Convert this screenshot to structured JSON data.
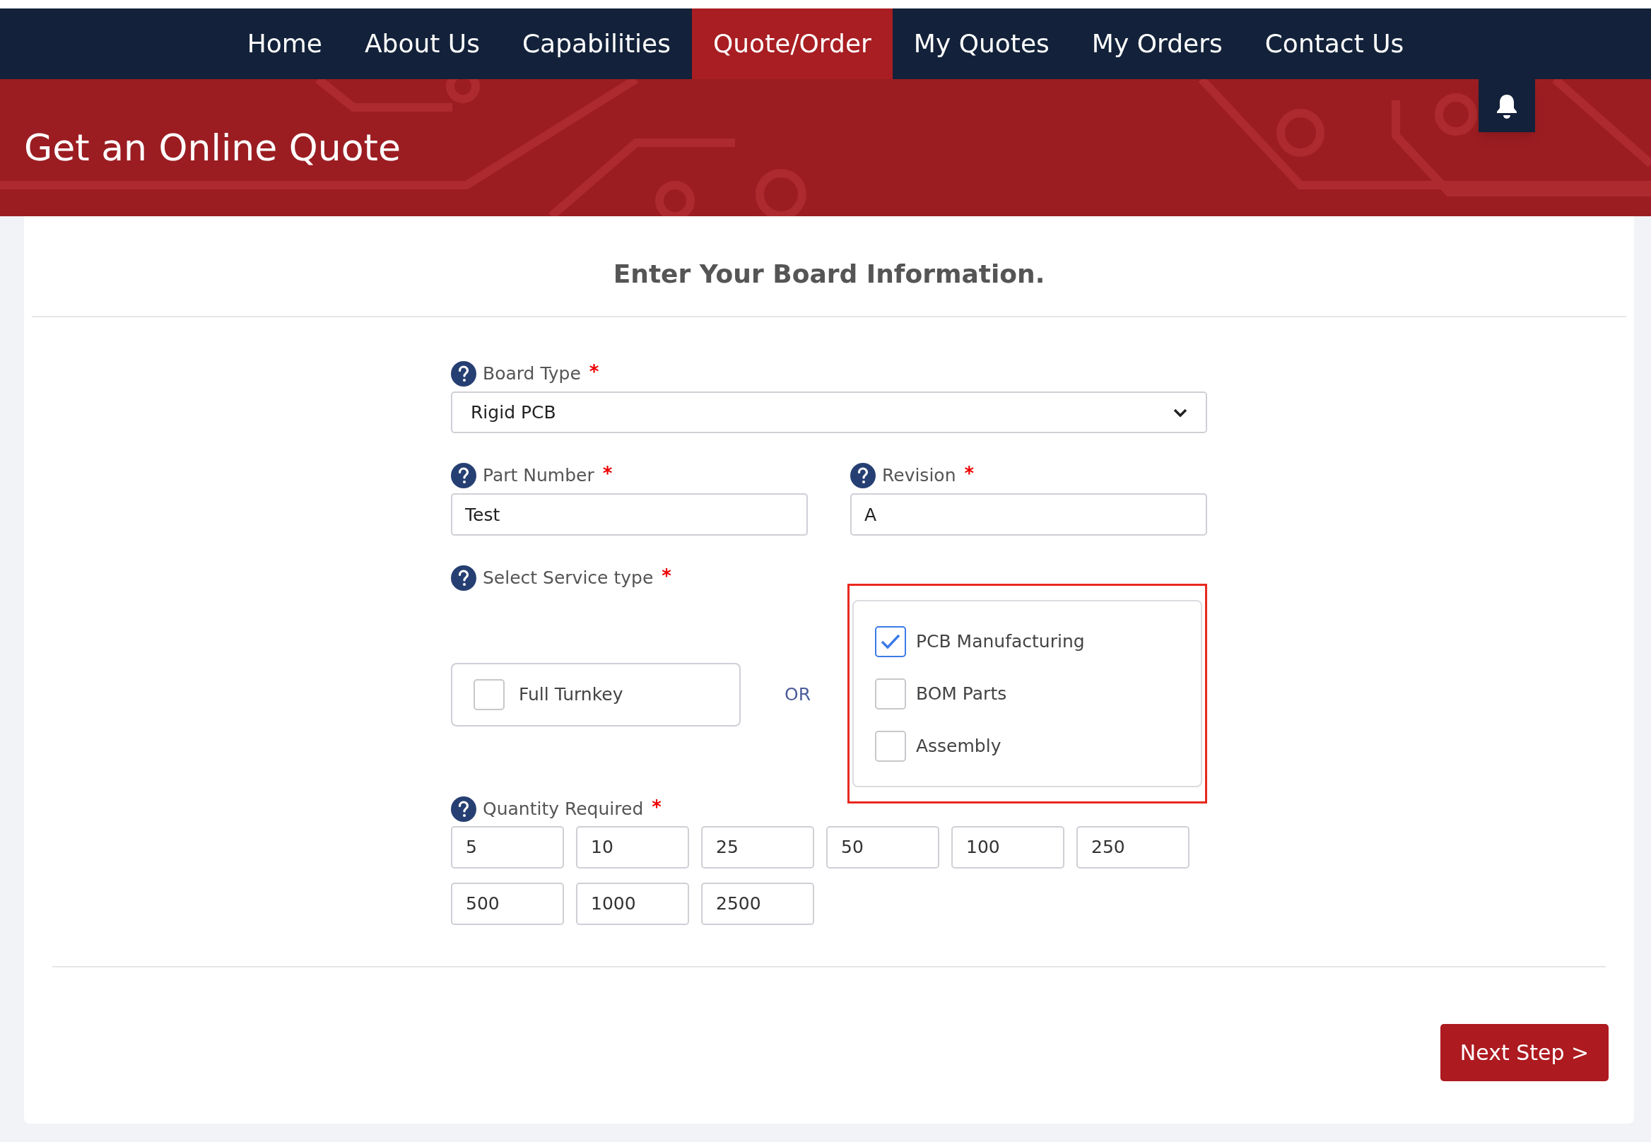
{
  "nav": {
    "items": [
      {
        "label": "Home",
        "selected": false
      },
      {
        "label": "About Us",
        "selected": false
      },
      {
        "label": "Capabilities",
        "selected": false
      },
      {
        "label": "Quote/Order",
        "selected": true
      },
      {
        "label": "My Quotes",
        "selected": false
      },
      {
        "label": "My Orders",
        "selected": false
      },
      {
        "label": "Contact Us",
        "selected": false
      }
    ]
  },
  "banner": {
    "title": "Get an Online Quote"
  },
  "form": {
    "heading": "Enter Your Board Information.",
    "board_type": {
      "label": "Board Type",
      "required_mark": "*",
      "value": "Rigid PCB"
    },
    "part_number": {
      "label": "Part Number",
      "required_mark": "*",
      "value": "Test"
    },
    "revision": {
      "label": "Revision",
      "required_mark": "*",
      "value": "A"
    },
    "service": {
      "label": "Select Service type",
      "required_mark": "*",
      "full_turnkey": {
        "label": "Full Turnkey",
        "checked": false
      },
      "or_text": "OR",
      "highlighted": true,
      "options": [
        {
          "label": "PCB Manufacturing",
          "checked": true
        },
        {
          "label": "BOM Parts",
          "checked": false
        },
        {
          "label": "Assembly",
          "checked": false
        }
      ]
    },
    "quantity": {
      "label": "Quantity Required",
      "required_mark": "*",
      "options": [
        "5",
        "10",
        "25",
        "50",
        "100",
        "250",
        "500",
        "1000",
        "2500"
      ]
    },
    "next_button": "Next Step >"
  }
}
